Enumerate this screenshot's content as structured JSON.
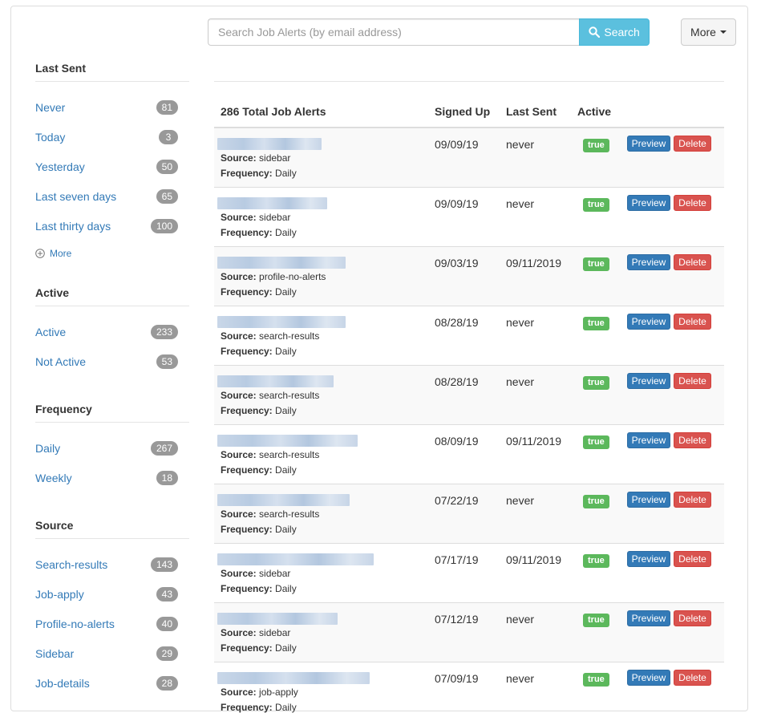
{
  "search": {
    "placeholder": "Search Job Alerts (by email address)",
    "button_label": "Search",
    "more_label": "More"
  },
  "sidebar": {
    "facets": [
      {
        "title": "Last Sent",
        "items": [
          {
            "label": "Never",
            "count": "81"
          },
          {
            "label": "Today",
            "count": "3"
          },
          {
            "label": "Yesterday",
            "count": "50"
          },
          {
            "label": "Last seven days",
            "count": "65"
          },
          {
            "label": "Last thirty days",
            "count": "100"
          }
        ]
      },
      {
        "title": "Active",
        "items": [
          {
            "label": "Active",
            "count": "233"
          },
          {
            "label": "Not Active",
            "count": "53"
          }
        ]
      },
      {
        "title": "Frequency",
        "items": [
          {
            "label": "Daily",
            "count": "267"
          },
          {
            "label": "Weekly",
            "count": "18"
          }
        ]
      },
      {
        "title": "Source",
        "items": [
          {
            "label": "Search-results",
            "count": "143"
          },
          {
            "label": "Job-apply",
            "count": "43"
          },
          {
            "label": "Profile-no-alerts",
            "count": "40"
          },
          {
            "label": "Sidebar",
            "count": "29"
          },
          {
            "label": "Job-details",
            "count": "28"
          }
        ]
      }
    ],
    "more_label": "More"
  },
  "table": {
    "headers": {
      "total": "286 Total Job Alerts",
      "signed_up": "Signed Up",
      "last_sent": "Last Sent",
      "active": "Active"
    },
    "labels": {
      "source": "Source:",
      "frequency": "Frequency:",
      "preview": "Preview",
      "delete": "Delete"
    },
    "rows": [
      {
        "source": "sidebar",
        "frequency": "Daily",
        "signed_up": "09/09/19",
        "last_sent": "never",
        "active": "true"
      },
      {
        "source": "sidebar",
        "frequency": "Daily",
        "signed_up": "09/09/19",
        "last_sent": "never",
        "active": "true"
      },
      {
        "source": "profile-no-alerts",
        "frequency": "Daily",
        "signed_up": "09/03/19",
        "last_sent": "09/11/2019",
        "active": "true"
      },
      {
        "source": "search-results",
        "frequency": "Daily",
        "signed_up": "08/28/19",
        "last_sent": "never",
        "active": "true"
      },
      {
        "source": "search-results",
        "frequency": "Daily",
        "signed_up": "08/28/19",
        "last_sent": "never",
        "active": "true"
      },
      {
        "source": "search-results",
        "frequency": "Daily",
        "signed_up": "08/09/19",
        "last_sent": "09/11/2019",
        "active": "true"
      },
      {
        "source": "search-results",
        "frequency": "Daily",
        "signed_up": "07/22/19",
        "last_sent": "never",
        "active": "true"
      },
      {
        "source": "sidebar",
        "frequency": "Daily",
        "signed_up": "07/17/19",
        "last_sent": "09/11/2019",
        "active": "true"
      },
      {
        "source": "sidebar",
        "frequency": "Daily",
        "signed_up": "07/12/19",
        "last_sent": "never",
        "active": "true"
      },
      {
        "source": "job-apply",
        "frequency": "Daily",
        "signed_up": "07/09/19",
        "last_sent": "never",
        "active": "true"
      }
    ]
  },
  "colors": {
    "link": "#337ab7",
    "search_button": "#5bc0de",
    "active_label": "#5cb85c",
    "preview_button": "#337ab7",
    "delete_button": "#d9534f",
    "badge": "#999999"
  }
}
